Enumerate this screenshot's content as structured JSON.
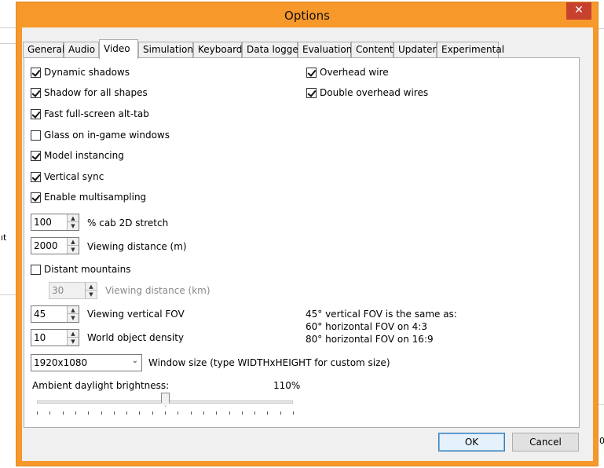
{
  "window": {
    "title": "Options",
    "close_glyph": "✕"
  },
  "tabs": [
    {
      "label": "General"
    },
    {
      "label": "Audio"
    },
    {
      "label": "Video",
      "active": true
    },
    {
      "label": "Simulation"
    },
    {
      "label": "Keyboard"
    },
    {
      "label": "Data logger"
    },
    {
      "label": "Evaluation"
    },
    {
      "label": "Content"
    },
    {
      "label": "Updater"
    },
    {
      "label": "Experimental"
    }
  ],
  "left_checks": [
    {
      "label": "Dynamic shadows",
      "checked": true
    },
    {
      "label": "Shadow for all shapes",
      "checked": true
    },
    {
      "label": "Fast full-screen alt-tab",
      "checked": true
    },
    {
      "label": "Glass on in-game windows",
      "checked": false
    },
    {
      "label": "Model instancing",
      "checked": true
    },
    {
      "label": "Vertical sync",
      "checked": true
    },
    {
      "label": "Enable multisampling",
      "checked": true
    }
  ],
  "right_checks": [
    {
      "label": "Overhead wire",
      "checked": true
    },
    {
      "label": "Double overhead wires",
      "checked": true
    }
  ],
  "cab_stretch": {
    "value": "100",
    "label": "% cab 2D stretch"
  },
  "viewing_distance": {
    "value": "2000",
    "label": "Viewing distance (m)"
  },
  "distant_mountains": {
    "label": "Distant mountains",
    "checked": false
  },
  "mountain_distance": {
    "value": "30",
    "label": "Viewing distance (km)"
  },
  "vertical_fov": {
    "value": "45",
    "label": "Viewing vertical FOV"
  },
  "object_density": {
    "value": "10",
    "label": "World object density"
  },
  "fov_note": [
    "45° vertical FOV is the same as:",
    "60° horizontal FOV on 4:3",
    "80° horizontal FOV on 16:9"
  ],
  "window_size": {
    "value": "1920x1080",
    "label": "Window size (type WIDTHxHEIGHT for custom size)"
  },
  "brightness": {
    "label": "Ambient daylight brightness:",
    "value_text": "110%",
    "level_fraction": 0.5,
    "tick_count": 21
  },
  "buttons": {
    "ok": "OK",
    "cancel": "Cancel"
  },
  "background": {
    "frag1": "ıt",
    "frag2": "50"
  },
  "icons": {
    "checkbox": "check-icon",
    "spin_up": "▲",
    "spin_down": "▼",
    "dropdown": "⌄"
  }
}
